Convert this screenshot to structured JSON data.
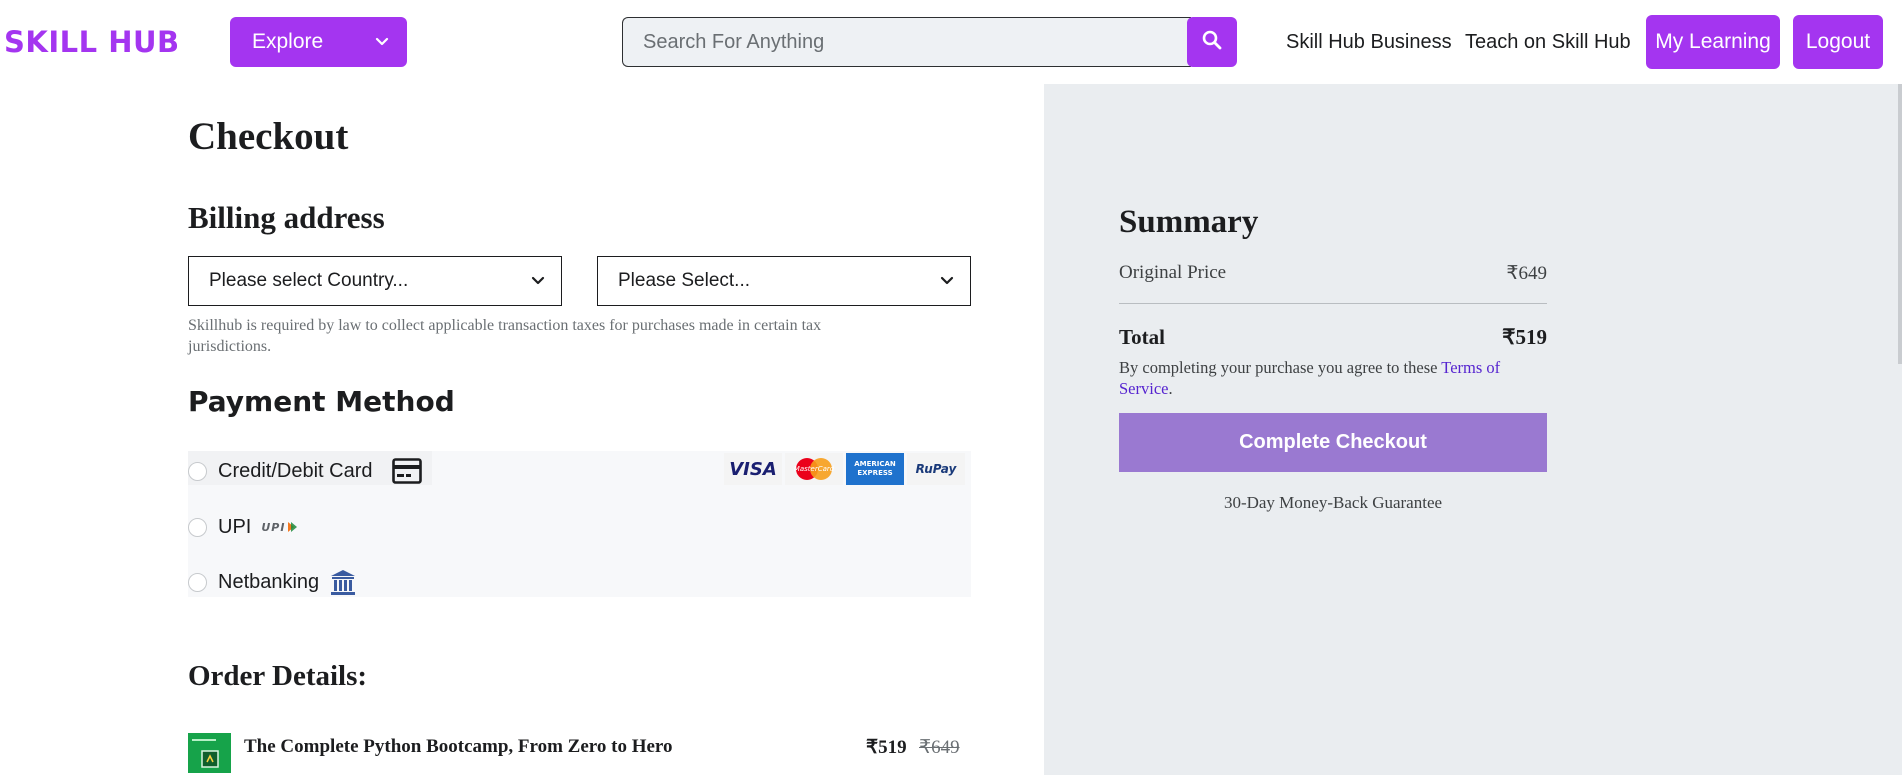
{
  "header": {
    "logo": "SKILL HUB",
    "explore_label": "Explore",
    "search": {
      "placeholder": "Search For Anything",
      "value": ""
    },
    "links": {
      "business": "Skill Hub Business",
      "teach": "Teach on Skill Hub"
    },
    "buttons": {
      "my_learning": "My Learning",
      "logout": "Logout"
    }
  },
  "checkout": {
    "title": "Checkout",
    "billing": {
      "heading": "Billing address",
      "country_placeholder": "Please select Country...",
      "state_placeholder": "Please Select...",
      "tax_note": "Skillhub is required by law to collect applicable transaction taxes for purchases made in certain tax jurisdictions."
    },
    "payment": {
      "heading": "Payment Method",
      "options": [
        "Credit/Debit Card",
        "UPI",
        "Netbanking"
      ],
      "card_brands": [
        "VISA",
        "MasterCard",
        "AMERICAN EXPRESS",
        "RuPay"
      ],
      "upi_mark": "UPI"
    },
    "order": {
      "heading": "Order Details:",
      "items": [
        {
          "title": "The Complete Python Bootcamp, From Zero to Hero",
          "price": "₹519",
          "original_price": "₹649"
        }
      ]
    }
  },
  "summary": {
    "title": "Summary",
    "original_label": "Original Price",
    "original_value": "₹649",
    "total_label": "Total",
    "total_value": "₹519",
    "terms_prefix": "By completing your purchase you agree to these ",
    "terms_link": "Terms of Service",
    "terms_suffix": ".",
    "checkout_label": "Complete Checkout",
    "guarantee": "30-Day Money-Back Guarantee"
  },
  "colors": {
    "brand": "#a435f0",
    "checkout_button": "#9a79d1",
    "summary_panel": "#eaedf0",
    "link": "#5624d0"
  }
}
